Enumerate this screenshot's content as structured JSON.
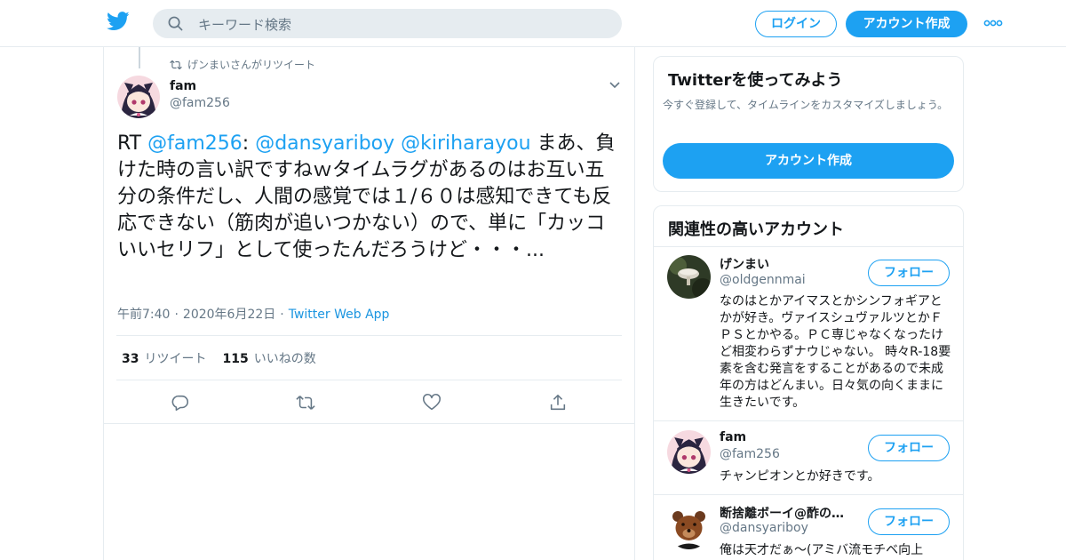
{
  "header": {
    "search_placeholder": "キーワード検索",
    "login_label": "ログイン",
    "signup_label": "アカウント作成"
  },
  "tweet": {
    "retweet_context": "げンまいさんがリツイート",
    "author_name": "fam",
    "author_handle": "@fam256",
    "text_prefix": "RT ",
    "mention1": "@fam256",
    "colon": ": ",
    "mention2": "@dansyariboy",
    "mention3": "@kiriharayou",
    "body": " まあ、負けた時の言い訳ですねｗタイムラグがあるのはお互い五分の条件だし、人間の感覚では１/６０は感知できても反応できない（筋肉が追いつかない）ので、単に「カッコいいセリフ」として使ったんだろうけど・・・...",
    "time": "午前7:40",
    "date": "2020年6月22日",
    "source": "Twitter Web App",
    "retweet_count": "33",
    "retweet_label": "リツイート",
    "like_count": "115",
    "like_label": "いいねの数"
  },
  "signup_card": {
    "title": "Twitterを使ってみよう",
    "description": "今すぐ登録して、タイムラインをカスタマイズしましょう。",
    "button_label": "アカウント作成"
  },
  "related": {
    "title": "関連性の高いアカウント",
    "follow_label": "フォロー",
    "accounts": [
      {
        "name": "げンまい",
        "handle": "@oldgennmai",
        "bio": "なのはとかアイマスとかシンフォギアとかが好き。ヴァイスシュヴァルツとかＦＰＳとかやる。ＰＣ専じゃなくなったけど相変わらずナウじゃない。 時々R-18要素を含む発言をすることがあるので未成年の方はどんまい。日々気の向くままに生きたいです。"
      },
      {
        "name": "fam",
        "handle": "@fam256",
        "bio": "チャンピオンとか好きです。"
      },
      {
        "name": "断捨離ボーイ@酢の…",
        "handle": "@dansyariboy",
        "bio": "俺は天才だぁ〜(アミバ流モチベ向上"
      }
    ]
  },
  "colors": {
    "accent": "#1da1f2",
    "text": "#14171a",
    "secondary": "#657786",
    "border": "#e6ecf0"
  },
  "icons": [
    "twitter-bird-icon",
    "search-icon",
    "more-icon",
    "retweet-icon",
    "chevron-down-icon",
    "reply-icon",
    "like-icon",
    "share-icon"
  ]
}
